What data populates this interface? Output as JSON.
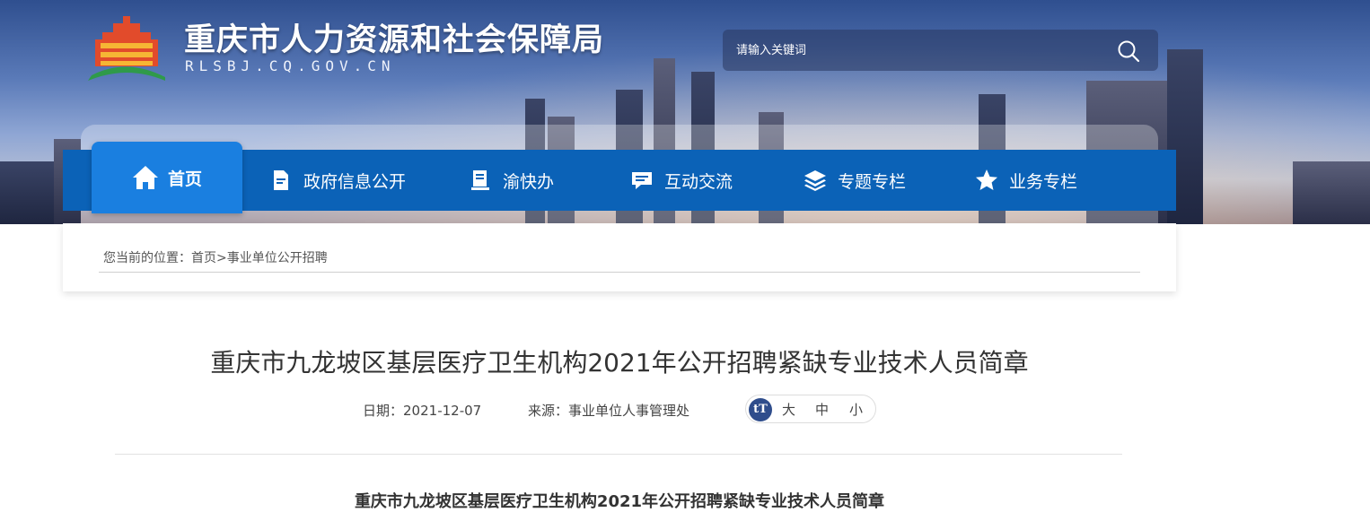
{
  "header": {
    "site_title": "重庆市人力资源和社会保障局",
    "site_domain": "RLSBJ.CQ.GOV.CN",
    "logo_icon": "government-building-logo"
  },
  "search": {
    "placeholder": "请输入关键词",
    "icon": "search-icon"
  },
  "nav": {
    "items": [
      {
        "label": "首页",
        "icon": "home-icon",
        "active": true
      },
      {
        "label": "政府信息公开",
        "icon": "document-icon"
      },
      {
        "label": "渝快办",
        "icon": "book-icon"
      },
      {
        "label": "互动交流",
        "icon": "chat-icon"
      },
      {
        "label": "专题专栏",
        "icon": "layers-icon"
      },
      {
        "label": "业务专栏",
        "icon": "star-icon"
      }
    ]
  },
  "breadcrumb": {
    "prefix": "您当前的位置：",
    "home": "首页",
    "separator": ">",
    "current": "事业单位公开招聘"
  },
  "article": {
    "title": "重庆市九龙坡区基层医疗卫生机构2021年公开招聘紧缺专业技术人员简章",
    "date_label": "日期：",
    "date": "2021-12-07",
    "source_label": "来源：",
    "source": "事业单位人事管理处",
    "font_size_icon": "tT",
    "font_sizes": [
      "大",
      "中",
      "小"
    ],
    "body_title": "重庆市九龙坡区基层医疗卫生机构2021年公开招聘紧缺专业技术人员简章"
  },
  "colors": {
    "nav_bg": "#0b62b7",
    "nav_active": "#1a7fe0",
    "font_icon_bg": "#2f4d8c"
  }
}
